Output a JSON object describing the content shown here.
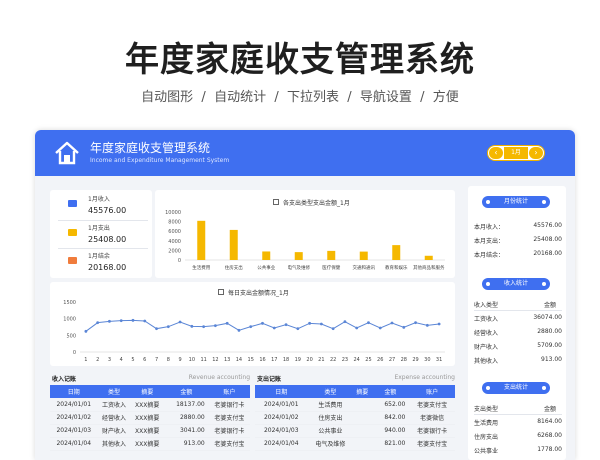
{
  "promo": {
    "title": "年度家庭收支管理系统",
    "subtitle": "自动图形  /  自动统计  /  下拉列表  /  导航设置  /  方便"
  },
  "header": {
    "title": "年度家庭收支管理系统",
    "subtitle": "Income and Expenditure Management System",
    "month": "1月",
    "prev_label": "‹",
    "next_label": "›",
    "home_icon": "home-icon",
    "accent": "#3f6ff0",
    "month_color": "#f5b800"
  },
  "stats": [
    {
      "label": "1月收入",
      "value": "45576.00",
      "icon": "income-icon",
      "color": "#3f6ff0"
    },
    {
      "label": "1月支出",
      "value": "25408.00",
      "icon": "expense-icon",
      "color": "#f5b800"
    },
    {
      "label": "1月结余",
      "value": "20168.00",
      "icon": "balance-icon",
      "color": "#f07c3c"
    }
  ],
  "chart_data": [
    {
      "type": "bar",
      "title": "各支出类型支出金额_1月",
      "categories": [
        "生活费用",
        "住房支出",
        "公共事业",
        "电气及维修",
        "医疗保健",
        "交通和通讯",
        "教育和娱乐",
        "其他商品和服务"
      ],
      "values": [
        8164,
        6268,
        1778,
        1640,
        1900,
        1750,
        3100,
        880
      ],
      "ylim": [
        0,
        10000
      ],
      "yticks": [
        "10000",
        "8000",
        "6000",
        "4000",
        "2000",
        "0"
      ],
      "color": "#f5b800"
    },
    {
      "type": "line",
      "title": "每日支出金额情况_1月",
      "x": [
        "1",
        "2",
        "3",
        "4",
        "5",
        "6",
        "7",
        "8",
        "9",
        "10",
        "11",
        "12",
        "13",
        "14",
        "15",
        "16",
        "17",
        "18",
        "19",
        "20",
        "21",
        "22",
        "23",
        "24",
        "25",
        "26",
        "27",
        "28",
        "29",
        "30",
        "31"
      ],
      "values": [
        620,
        880,
        920,
        940,
        950,
        930,
        700,
        760,
        900,
        770,
        760,
        790,
        860,
        650,
        760,
        860,
        720,
        820,
        700,
        860,
        840,
        700,
        910,
        720,
        880,
        720,
        870,
        740,
        880,
        800,
        840
      ],
      "ylim": [
        0,
        1500
      ],
      "yticks": [
        "1500",
        "1000",
        "500",
        "0"
      ],
      "color": "#5b86d6"
    }
  ],
  "income_table": {
    "title": "收入记账",
    "subtitle": "Revenue accounting",
    "columns": [
      "日期",
      "类型",
      "摘要",
      "金额",
      "账户"
    ],
    "rows": [
      [
        "2024/01/01",
        "工资收入",
        "XXX摘要",
        "18137.00",
        "老婆银行卡"
      ],
      [
        "2024/01/02",
        "经营收入",
        "XXX摘要",
        "2880.00",
        "老婆支付宝"
      ],
      [
        "2024/01/03",
        "财产收入",
        "XXX摘要",
        "3041.00",
        "老婆银行卡"
      ],
      [
        "2024/01/04",
        "其他收入",
        "XXX摘要",
        "913.00",
        "老婆支付宝"
      ]
    ]
  },
  "expense_table": {
    "title": "支出记账",
    "subtitle": "Expense accounting",
    "columns": [
      "日期",
      "类型",
      "摘要",
      "金额",
      "账户"
    ],
    "rows": [
      [
        "2024/01/01",
        "生活费用",
        "",
        "652.00",
        "老婆支付宝"
      ],
      [
        "2024/01/02",
        "住房支出",
        "",
        "842.00",
        "老婆微信"
      ],
      [
        "2024/01/03",
        "公共事业",
        "",
        "940.00",
        "老婆银行卡"
      ],
      [
        "2024/01/04",
        "电气及维修",
        "",
        "821.00",
        "老婆支付宝"
      ]
    ]
  },
  "right_panel": {
    "monthly_label": "月份统计",
    "monthly": [
      {
        "k": "本月收入：",
        "v": "45576.00"
      },
      {
        "k": "本月支出：",
        "v": "25408.00"
      },
      {
        "k": "本月结余：",
        "v": "20168.00"
      }
    ],
    "income_label": "收入统计",
    "income_head": {
      "k": "收入类型",
      "v": "金额"
    },
    "income_rows": [
      {
        "k": "工资收入",
        "v": "36074.00"
      },
      {
        "k": "经营收入",
        "v": "2880.00"
      },
      {
        "k": "财产收入",
        "v": "5709.00"
      },
      {
        "k": "其他收入",
        "v": "913.00"
      }
    ],
    "expense_label": "支出统计",
    "expense_head": {
      "k": "支出类型",
      "v": "金额"
    },
    "expense_rows": [
      {
        "k": "生活费用",
        "v": "8164.00"
      },
      {
        "k": "住房支出",
        "v": "6268.00"
      },
      {
        "k": "公共事业",
        "v": "1778.00"
      }
    ]
  }
}
